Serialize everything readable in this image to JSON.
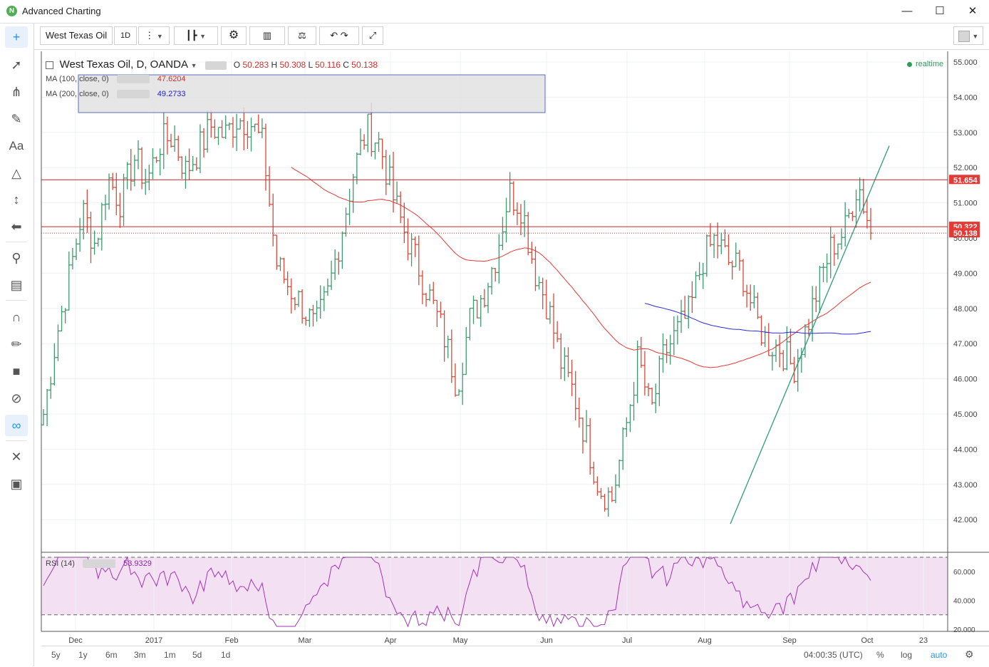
{
  "window": {
    "title": "Advanced Charting",
    "minimize_icon": "minimize-icon",
    "maximize_icon": "maximize-icon",
    "close_icon": "close-icon"
  },
  "toolbar": {
    "symbol": "West Texas Oil",
    "interval": "1D",
    "icons": [
      "interval-menu-icon",
      "bar-style-icon",
      "settings-gear-icon",
      "indicators-icon",
      "compare-icon",
      "undo-icon",
      "redo-icon",
      "fullscreen-icon"
    ],
    "color_swatch": "#d6d6d6"
  },
  "left_tools": [
    "crosshair-icon",
    "trend-line-icon",
    "pitchfork-icon",
    "brush-icon",
    "text-tool-icon",
    "pattern-icon",
    "measure-icon",
    "arrow-back-icon",
    "zoom-icon",
    "ruler-icon",
    "magnet-icon",
    "pencil-lock-icon",
    "lock-icon",
    "eye-hide-icon",
    "link-icon",
    "tools-icon",
    "trash-icon"
  ],
  "legend": {
    "symbol_line": "West Texas Oil, D, OANDA",
    "o_label": "O",
    "o_value": "50.283",
    "h_label": "H",
    "h_value": "50.308",
    "l_label": "L",
    "l_value": "50.116",
    "c_label": "C",
    "c_value": "50.138",
    "ma100_label": "MA (100, close, 0)",
    "ma100_value": "47.6204",
    "ma200_label": "MA (200, close, 0)",
    "ma200_value": "49.2733",
    "rsi_label": "RSI (14)",
    "rsi_value": "53.9329",
    "realtime": "realtime"
  },
  "colors": {
    "up_bar": "#3d9b6d",
    "down_bar": "#d84a3a",
    "ma100": "#e53935",
    "ma200": "#2a2ad8",
    "trendline": "#2e9c7a",
    "rsi": "#a432b8",
    "rsi_band": "#f3e1f3",
    "hline": "#c62828"
  },
  "chart_data": {
    "type": "ohlc",
    "symbol": "West Texas Oil",
    "ylim": [
      41.5,
      55.3
    ],
    "y_ticks": [
      "55.000",
      "54.000",
      "53.000",
      "52.000",
      "51.000",
      "50.000",
      "49.000",
      "48.000",
      "47.000",
      "46.000",
      "45.000",
      "44.000",
      "43.000",
      "42.000"
    ],
    "x_ticks": [
      "Dec",
      "2017",
      "Feb",
      "Mar",
      "Apr",
      "May",
      "Jun",
      "Jul",
      "Aug",
      "Sep",
      "Oct",
      "23"
    ],
    "price_markers": [
      {
        "label": "51.654",
        "value": 51.654
      },
      {
        "label": "50.322",
        "value": 50.322
      },
      {
        "label": "50.138",
        "value": 50.138
      }
    ],
    "closes_approx": [
      45.0,
      47.2,
      48.9,
      50.8,
      49.8,
      51.7,
      51.0,
      52.3,
      51.6,
      52.7,
      52.9,
      51.9,
      52.5,
      53.2,
      52.9,
      53.4,
      53.3,
      52.6,
      49.3,
      48.6,
      48.1,
      47.4,
      48.4,
      50.1,
      51.9,
      53.1,
      52.7,
      51.2,
      50.1,
      49.2,
      48.2,
      47.2,
      45.8,
      47.7,
      48.4,
      49.5,
      51.3,
      50.9,
      49.1,
      48.1,
      46.5,
      45.6,
      44.3,
      42.9,
      42.6,
      44.5,
      46.6,
      45.0,
      46.7,
      47.3,
      47.9,
      49.4,
      50.0,
      49.3,
      49.1,
      47.8,
      47.0,
      46.9,
      46.3,
      47.4,
      48.7,
      49.8,
      50.2,
      51.6,
      50.2
    ],
    "rsi": {
      "name": "RSI (14)",
      "ylim": [
        20,
        70
      ],
      "y_ticks": [
        "60.000",
        "40.000",
        "20.000"
      ],
      "levels": [
        70,
        30
      ],
      "last": 53.9329
    },
    "ma100_last": 47.6204,
    "ma200_last": 49.2733
  },
  "bottom": {
    "ranges": [
      "5y",
      "1y",
      "6m",
      "3m",
      "1m",
      "5d",
      "1d"
    ],
    "time": "04:00:35 (UTC)",
    "percent": "%",
    "log": "log",
    "auto": "auto",
    "settings_icon": "gear-icon"
  }
}
